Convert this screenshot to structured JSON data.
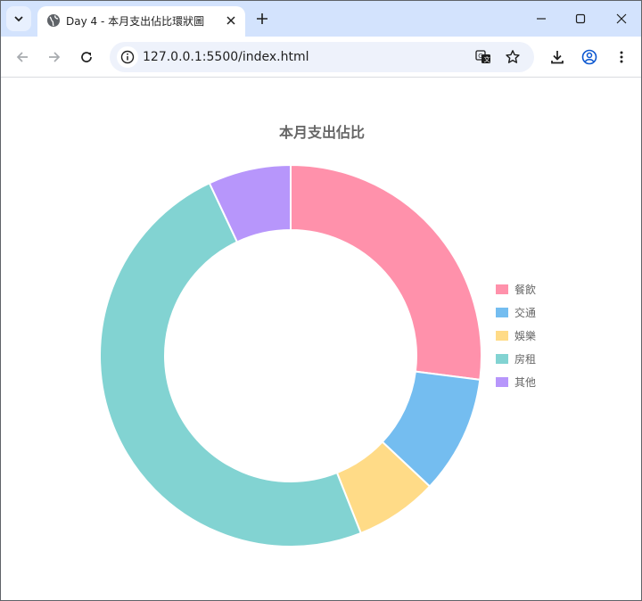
{
  "browser": {
    "tab_title": "Day 4 - 本月支出佔比環狀圖",
    "url": "127.0.0.1:5500/index.html"
  },
  "icons": {
    "tab_search": "chevron-down-icon",
    "favicon": "globe-icon",
    "close": "close-icon",
    "new_tab": "plus-icon",
    "minimize": "minimize-icon",
    "maximize": "maximize-icon",
    "window_close": "close-icon",
    "back": "arrow-left-icon",
    "forward": "arrow-right-icon",
    "reload": "reload-icon",
    "site_info": "info-icon",
    "translate": "translate-icon",
    "bookmark": "star-icon",
    "download": "download-icon",
    "profile": "profile-icon",
    "menu": "kebab-menu-icon"
  },
  "chart_data": {
    "type": "pie",
    "variant": "doughnut",
    "title": "本月支出佔比",
    "categories": [
      "餐飲",
      "交通",
      "娛樂",
      "房租",
      "其他"
    ],
    "values": [
      27,
      10,
      7,
      49,
      7
    ],
    "colors": [
      "#ff91ab",
      "#74bdf0",
      "#ffdb87",
      "#82d3d2",
      "#b796fb"
    ],
    "legend": "right"
  }
}
